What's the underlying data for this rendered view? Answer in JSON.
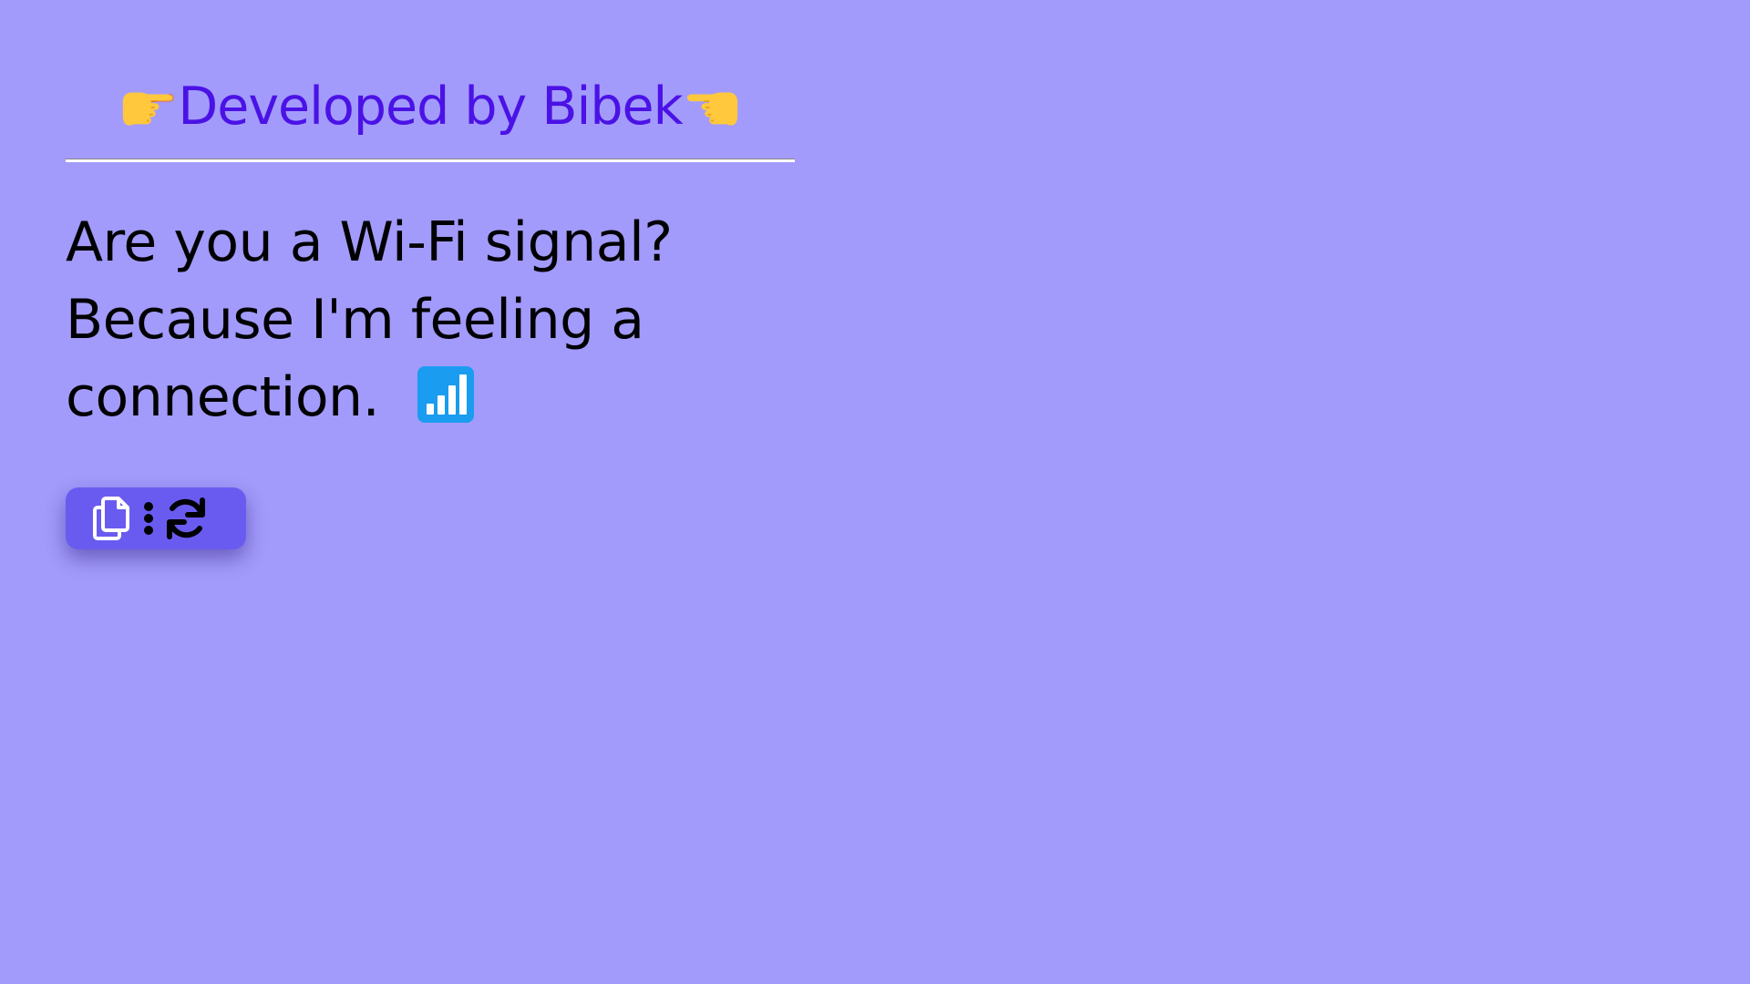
{
  "header": {
    "left_icon": "pointing-right-hand-icon",
    "text": "Developed by Bibek",
    "right_icon": "pointing-left-hand-icon",
    "text_color": "#4b12e6"
  },
  "quote": {
    "text": "Are you a Wi-Fi signal? Because I'm feeling a connection.",
    "emoji_icon": "signal-bars-icon"
  },
  "toolbar": {
    "buttons": [
      {
        "name": "copy-button",
        "icon": "copy-icon"
      },
      {
        "name": "menu-button",
        "icon": "vertical-dots-icon"
      },
      {
        "name": "refresh-button",
        "icon": "refresh-icon"
      }
    ],
    "background": "#6a5bf0"
  },
  "colors": {
    "page_background": "#a29bfb",
    "text": "#000000",
    "accent": "#4b12e6"
  }
}
